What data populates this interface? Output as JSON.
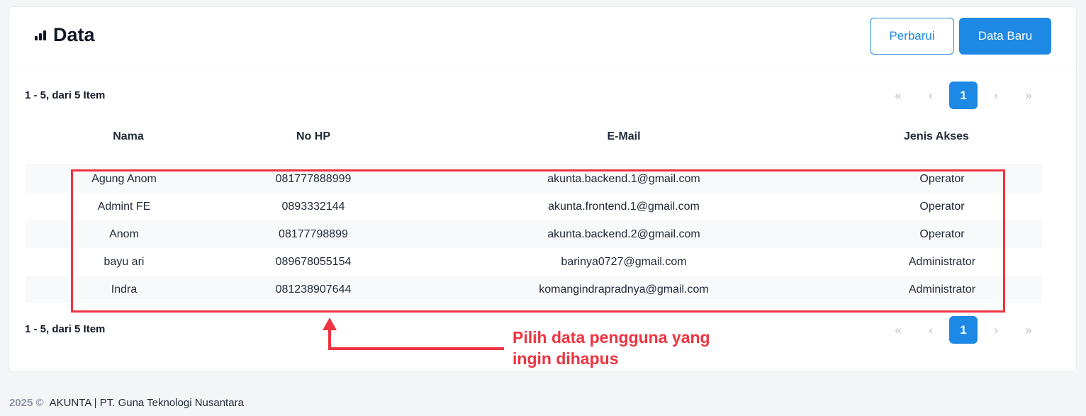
{
  "header": {
    "title": "Data",
    "refresh_label": "Perbarui",
    "new_label": "Data Baru"
  },
  "summary": {
    "top": "1 - 5, dari 5 Item",
    "bottom": "1 - 5, dari 5 Item"
  },
  "pagination": {
    "first": "«",
    "prev": "‹",
    "current": "1",
    "next": "›",
    "last": "»"
  },
  "table": {
    "columns": [
      "Nama",
      "No HP",
      "E-Mail",
      "Jenis Akses"
    ],
    "rows": [
      [
        "Agung Anom",
        "081777888999",
        "akunta.backend.1@gmail.com",
        "Operator"
      ],
      [
        "Admint FE",
        "0893332144",
        "akunta.frontend.1@gmail.com",
        "Operator"
      ],
      [
        "Anom",
        "08177798899",
        "akunta.backend.2@gmail.com",
        "Operator"
      ],
      [
        "bayu ari",
        "089678055154",
        "barinya0727@gmail.com",
        "Administrator"
      ],
      [
        "Indra",
        "081238907644",
        "komangindrapradnya@gmail.com",
        "Administrator"
      ]
    ]
  },
  "annotation": {
    "line1": "Pilih data pengguna yang",
    "line2": "ingin dihapus"
  },
  "footer": {
    "year": "2025 ©",
    "text": "AKUNTA | PT. Guna Teknologi Nusantara"
  },
  "colors": {
    "primary": "#1e88e5",
    "annotation": "#ef3340"
  },
  "icons": {
    "title": "bar-chart-icon"
  }
}
